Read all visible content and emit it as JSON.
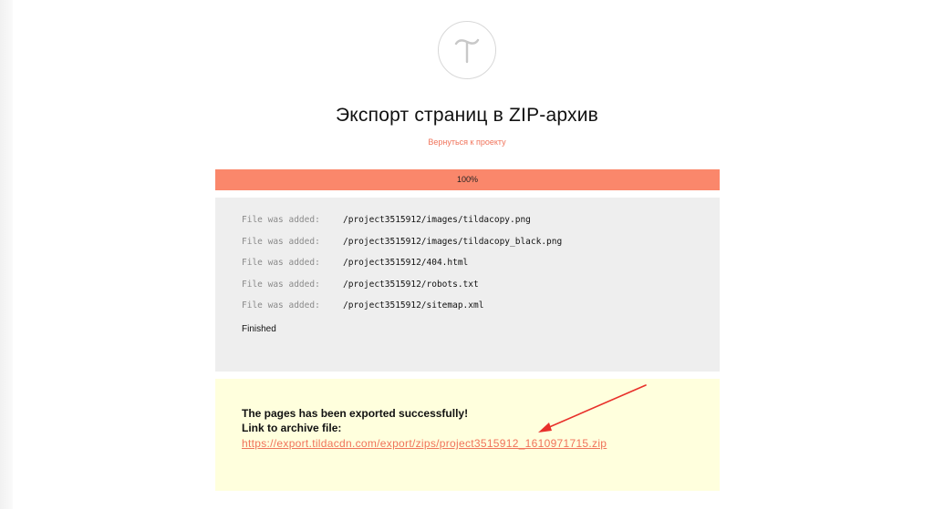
{
  "header": {
    "logo_icon": "tilda-logo-icon",
    "title": "Экспорт страниц в ZIP-архив",
    "back_link": "Вернуться к проекту"
  },
  "progress": {
    "value": 100,
    "label": "100%",
    "color": "#fa876b"
  },
  "log": {
    "entries": [
      {
        "label": "File was added:",
        "path": "/project3515912/images/tildacopy.png"
      },
      {
        "label": "File was added:",
        "path": "/project3515912/images/tildacopy_black.png"
      },
      {
        "label": "File was added:",
        "path": "/project3515912/404.html"
      },
      {
        "label": "File was added:",
        "path": "/project3515912/robots.txt"
      },
      {
        "label": "File was added:",
        "path": "/project3515912/sitemap.xml"
      }
    ],
    "finished": "Finished"
  },
  "result": {
    "success_text": "The pages has been exported successfully!",
    "link_label": "Link to archive file:",
    "archive_url": "https://export.tildacdn.com/export/zips/project3515912_1610971715.zip",
    "background": "#ffffdd",
    "link_color": "#f0735a"
  },
  "annotation": {
    "arrow_icon": "red-arrow-icon",
    "color": "#e8302a"
  }
}
